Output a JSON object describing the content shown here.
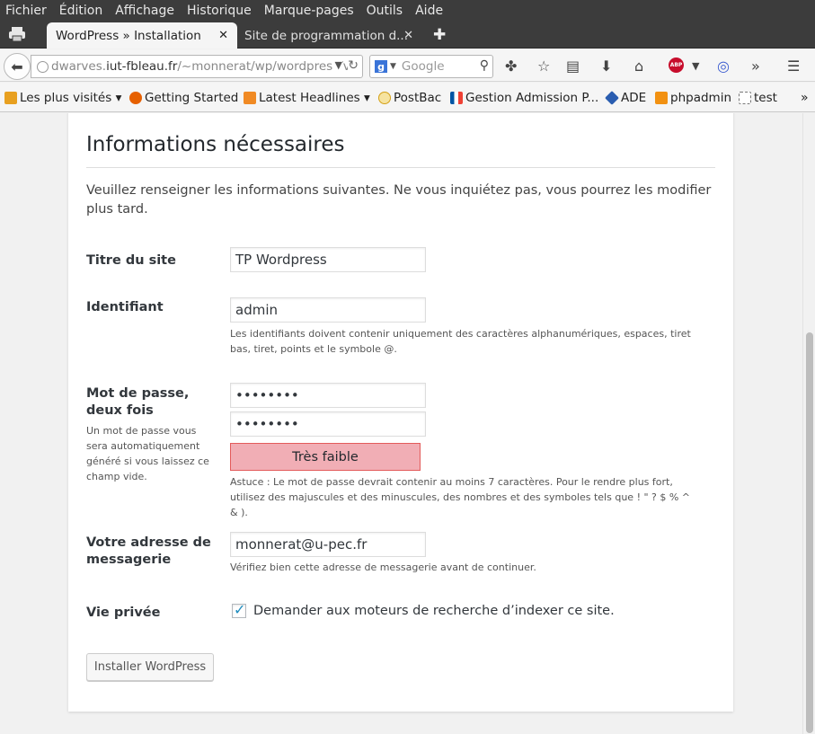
{
  "menubar": {
    "items": [
      "Fichier",
      "Édition",
      "Affichage",
      "Historique",
      "Marque-pages",
      "Outils",
      "Aide"
    ]
  },
  "tabs": [
    {
      "title": "WordPress » Installation",
      "active": true
    },
    {
      "title": "Site de programmation d...",
      "active": false
    }
  ],
  "navbar": {
    "url_prefix": "dwarves.",
    "url_host": "iut-fbleau.fr",
    "url_path": "/~monnerat/wp/wordpress/v",
    "search_placeholder": "Google",
    "search_engine_letter": "g"
  },
  "bookmarks": [
    {
      "label": "Les plus visités ▾",
      "icon": "most-visited-icon",
      "color": "#e8a020"
    },
    {
      "label": "Getting Started",
      "icon": "firefox-icon",
      "color": "#e66000"
    },
    {
      "label": "Latest Headlines ▾",
      "icon": "rss-icon",
      "color": "#f08a24"
    },
    {
      "label": "PostBac",
      "icon": "postbac-icon",
      "color": "#d4a017"
    },
    {
      "label": "Gestion Admission P...",
      "icon": "france-flag-icon",
      "color": "#0055a4"
    },
    {
      "label": "ADE",
      "icon": "ade-icon",
      "color": "#2a5db0"
    },
    {
      "label": "phpadmin",
      "icon": "pma-icon",
      "color": "#f29111"
    },
    {
      "label": "test",
      "icon": "blank-page-icon",
      "color": "#ffffff"
    }
  ],
  "page": {
    "title": "Informations nécessaires",
    "intro": "Veuillez renseigner les informations suivantes. Ne vous inquiétez pas, vous pourrez les modifier plus tard.",
    "site_title": {
      "label": "Titre du site",
      "value": "TP Wordpress"
    },
    "username": {
      "label": "Identifiant",
      "value": "admin",
      "help": "Les identifiants doivent contenir uniquement des caractères alphanumériques, espaces, tiret bas, tiret, points et le symbole @."
    },
    "password": {
      "label": "Mot de passe, deux fois",
      "side_help": "Un mot de passe vous sera automatiquement généré si vous laissez ce champ vide.",
      "value1": "••••••••",
      "value2": "••••••••",
      "strength": "Très faible",
      "hint": "Astuce : Le mot de passe devrait contenir au moins 7 caractères. Pour le rendre plus fort, utilisez des majuscules et des minuscules, des nombres et des symboles tels que ! \" ? $ % ^ & )."
    },
    "email": {
      "label": "Votre adresse de messagerie",
      "value": "monnerat@u-pec.fr",
      "help": "Vérifiez bien cette adresse de messagerie avant de continuer."
    },
    "privacy": {
      "label": "Vie privée",
      "checkbox_label": "Demander aux moteurs de recherche d’indexer ce site.",
      "checked": true
    },
    "submit_label": "Installer WordPress"
  },
  "colors": {
    "strength_bg": "#f1aeb5",
    "strength_border": "#e35b5b",
    "checkbox_tick": "#1e8cbe"
  }
}
